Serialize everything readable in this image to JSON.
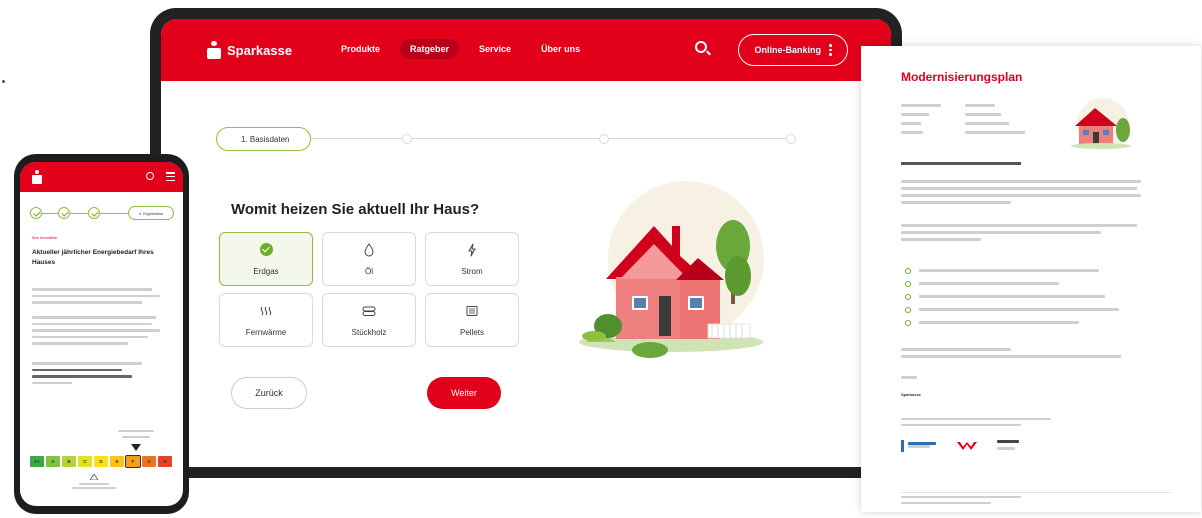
{
  "tablet": {
    "brand": "Sparkasse",
    "nav": [
      "Produkte",
      "Ratgeber",
      "Service",
      "Über uns"
    ],
    "active_nav": "Ratgeber",
    "online_banking": "Online-Banking",
    "step_label": "1. Basisdaten",
    "question": "Womit heizen Sie aktuell Ihr Haus?",
    "options": [
      {
        "label": "Erdgas",
        "icon": "check-icon",
        "selected": true
      },
      {
        "label": "Öl",
        "icon": "drop-icon",
        "selected": false
      },
      {
        "label": "Strom",
        "icon": "lightning-icon",
        "selected": false
      },
      {
        "label": "Fernwärme",
        "icon": "heat-icon",
        "selected": false
      },
      {
        "label": "Stückholz",
        "icon": "wood-icon",
        "selected": false
      },
      {
        "label": "Pellets",
        "icon": "pellets-icon",
        "selected": false
      }
    ],
    "back": "Zurück",
    "next": "Weiter"
  },
  "doc": {
    "title": "Modernisierungsplan",
    "sender": "Sparkasse"
  },
  "phone": {
    "step_pill": "4. Ergebnisse",
    "section_label": "Ihre Immobilie",
    "heading": "Aktueller jährlicher Energiebedarf Ihres Hauses",
    "scale": [
      "A+",
      "A",
      "B",
      "C",
      "D",
      "E",
      "F",
      "G",
      "H"
    ],
    "highlight": "G"
  },
  "colors": {
    "brand_red": "#e3001b",
    "accent_green": "#8fbf3c"
  }
}
